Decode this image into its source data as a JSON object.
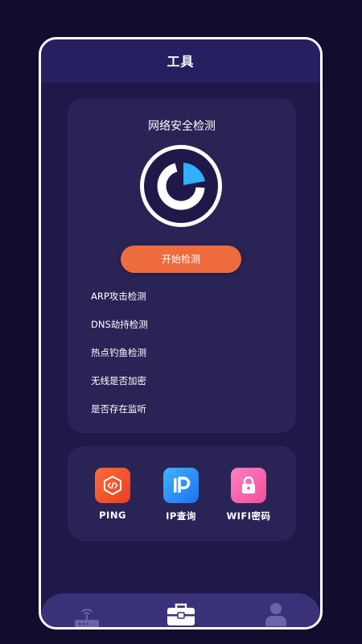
{
  "header": {
    "title": "工具"
  },
  "security_check": {
    "title": "网络安全检测",
    "start_button": "开始检测",
    "items": [
      "ARP攻击检测",
      "DNS劫持检测",
      "热点钓鱼检测",
      "无线是否加密",
      "是否存在监听"
    ]
  },
  "tools": {
    "ping": {
      "label": "PING",
      "icon": "code-brackets-icon",
      "color": "#f0542b"
    },
    "ip": {
      "label": "IP查询",
      "icon": "ip-letter-icon",
      "color": "#2d8ef6"
    },
    "wifi": {
      "label": "WIFI密码",
      "icon": "lock-icon",
      "color": "#f965ad"
    }
  },
  "bottom_nav": {
    "items": [
      {
        "icon": "router-icon",
        "active": false
      },
      {
        "icon": "toolbox-icon",
        "active": true
      },
      {
        "icon": "user-icon",
        "active": false
      }
    ]
  },
  "colors": {
    "background": "#120c2e",
    "card": "#2a2356",
    "accent": "#ee6b3e",
    "gauge_accent": "#2fb0ff"
  }
}
